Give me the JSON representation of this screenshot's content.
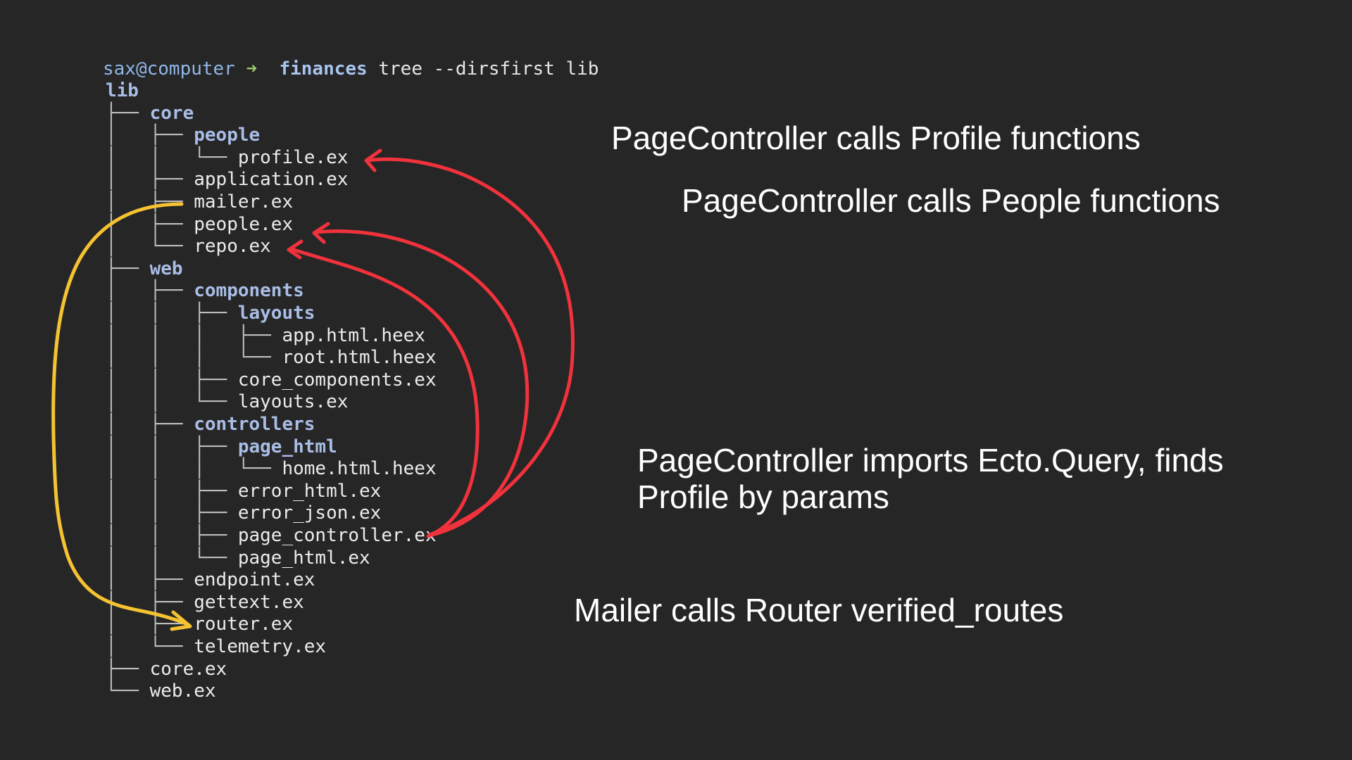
{
  "terminal": {
    "prompt_user": "sax@computer",
    "prompt_arrow": "➜",
    "prompt_cwd": "finances",
    "command": "tree --dirsfirst lib",
    "tree": [
      {
        "prefix": "",
        "name": "lib",
        "kind": "dir"
      },
      {
        "prefix": "├── ",
        "name": "core",
        "kind": "dir"
      },
      {
        "prefix": "│   ├── ",
        "name": "people",
        "kind": "dir"
      },
      {
        "prefix": "│   │   └── ",
        "name": "profile.ex",
        "kind": "file"
      },
      {
        "prefix": "│   ├── ",
        "name": "application.ex",
        "kind": "file"
      },
      {
        "prefix": "│   ├── ",
        "name": "mailer.ex",
        "kind": "file"
      },
      {
        "prefix": "│   ├── ",
        "name": "people.ex",
        "kind": "file"
      },
      {
        "prefix": "│   └── ",
        "name": "repo.ex",
        "kind": "file"
      },
      {
        "prefix": "├── ",
        "name": "web",
        "kind": "dir"
      },
      {
        "prefix": "│   ├── ",
        "name": "components",
        "kind": "dir"
      },
      {
        "prefix": "│   │   ├── ",
        "name": "layouts",
        "kind": "dir"
      },
      {
        "prefix": "│   │   │   ├── ",
        "name": "app.html.heex",
        "kind": "file"
      },
      {
        "prefix": "│   │   │   └── ",
        "name": "root.html.heex",
        "kind": "file"
      },
      {
        "prefix": "│   │   ├── ",
        "name": "core_components.ex",
        "kind": "file"
      },
      {
        "prefix": "│   │   └── ",
        "name": "layouts.ex",
        "kind": "file"
      },
      {
        "prefix": "│   ├── ",
        "name": "controllers",
        "kind": "dir"
      },
      {
        "prefix": "│   │   ├── ",
        "name": "page_html",
        "kind": "dir"
      },
      {
        "prefix": "│   │   │   └── ",
        "name": "home.html.heex",
        "kind": "file"
      },
      {
        "prefix": "│   │   ├── ",
        "name": "error_html.ex",
        "kind": "file"
      },
      {
        "prefix": "│   │   ├── ",
        "name": "error_json.ex",
        "kind": "file"
      },
      {
        "prefix": "│   │   ├── ",
        "name": "page_controller.ex",
        "kind": "file"
      },
      {
        "prefix": "│   │   └── ",
        "name": "page_html.ex",
        "kind": "file"
      },
      {
        "prefix": "│   ├── ",
        "name": "endpoint.ex",
        "kind": "file"
      },
      {
        "prefix": "│   ├── ",
        "name": "gettext.ex",
        "kind": "file"
      },
      {
        "prefix": "│   ├── ",
        "name": "router.ex",
        "kind": "file"
      },
      {
        "prefix": "│   └── ",
        "name": "telemetry.ex",
        "kind": "file"
      },
      {
        "prefix": "├── ",
        "name": "core.ex",
        "kind": "file"
      },
      {
        "prefix": "└── ",
        "name": "web.ex",
        "kind": "file"
      }
    ]
  },
  "annotations": {
    "profile_calls": "PageController calls Profile functions",
    "people_calls": "PageController calls People functions",
    "ecto_query": "PageController imports Ecto.Query, finds\nProfile by params",
    "mailer_router": "Mailer calls Router verified_routes"
  },
  "colors": {
    "background": "#262626",
    "red_arrow": "#f0323c",
    "yellow_arrow": "#f5c232",
    "dir_text": "#a9bde6",
    "file_text": "#ececec"
  }
}
